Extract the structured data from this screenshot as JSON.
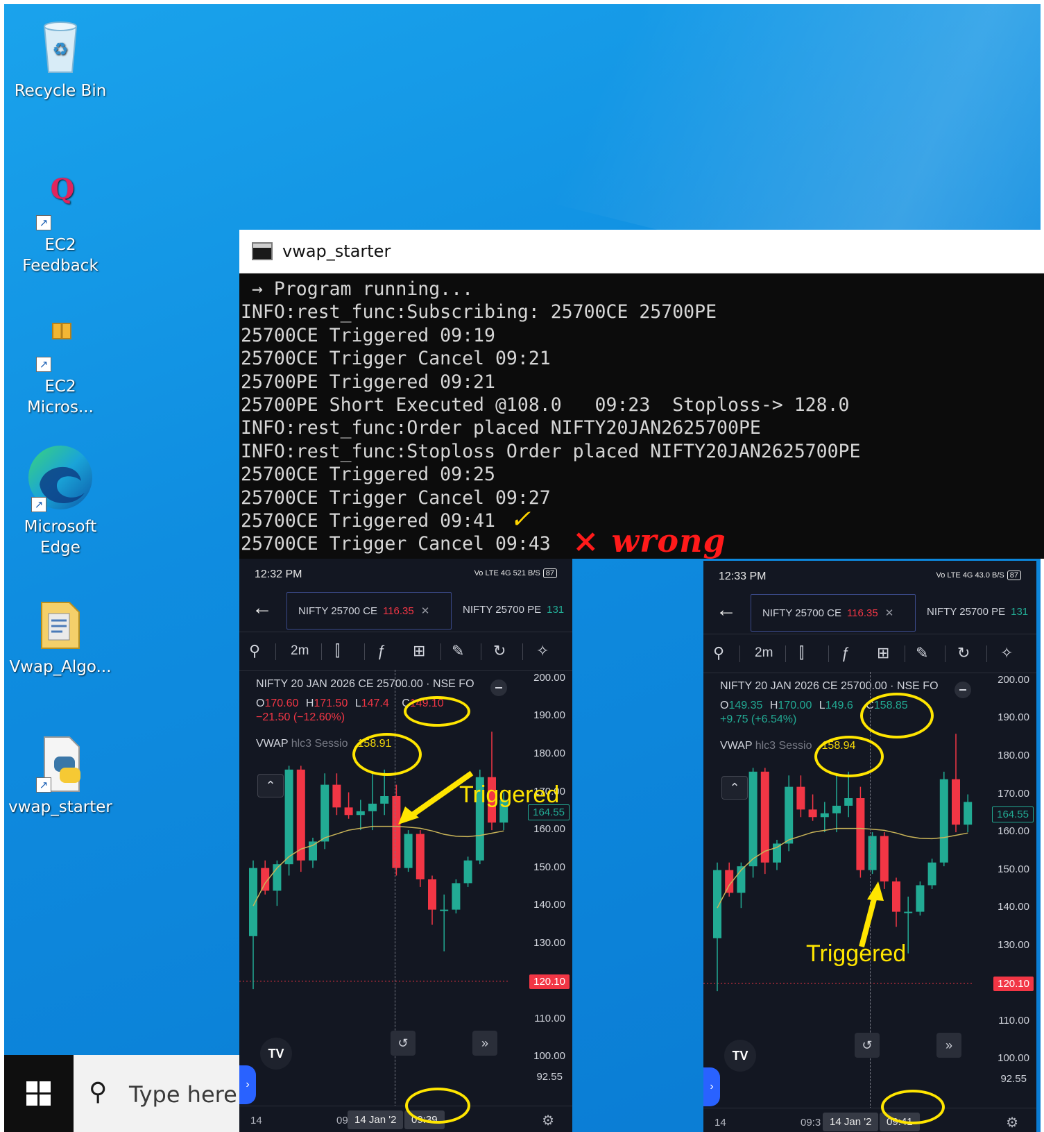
{
  "desktop_icons": [
    {
      "label": "Recycle Bin",
      "icon": "recycle-bin-icon"
    },
    {
      "label_lines": [
        "EC2",
        "Feedback"
      ],
      "icon": "q-icon"
    },
    {
      "label_lines": [
        "EC2",
        "Micros..."
      ],
      "icon": "package-icon"
    },
    {
      "label_lines": [
        "Microsoft",
        "Edge"
      ],
      "icon": "edge-icon"
    },
    {
      "label": "Vwap_Algo...",
      "icon": "folder-icon"
    },
    {
      "label": "vwap_starter",
      "icon": "python-file-icon"
    }
  ],
  "taskbar": {
    "search_placeholder": "Type here t"
  },
  "console": {
    "title": "vwap_starter",
    "lines": [
      " → Program running...",
      "INFO:rest_func:Subscribing: 25700CE 25700PE",
      "25700CE Triggered 09:19",
      "25700CE Trigger Cancel 09:21",
      "25700PE Triggered 09:21",
      "25700PE Short Executed @108.0   09:23  Stoploss-> 128.0",
      "INFO:rest_func:Order placed NIFTY20JAN2625700PE",
      "INFO:rest_func:Stoploss Order placed NIFTY20JAN2625700PE",
      "25700CE Triggered 09:25",
      "25700CE Trigger Cancel 09:27",
      "25700CE Triggered 09:41",
      "25700CE Trigger Cancel 09:43"
    ],
    "annotation_check": "✓",
    "annotation_wrong": "× wrong"
  },
  "phones": [
    {
      "status_time": "12:32 PM",
      "status_signal": "Vo LTE 4G 521 B/S",
      "battery": "87",
      "tab1_name": "NIFTY 25700 CE",
      "tab1_price": "116.35",
      "tab2_name": "NIFTY 25700 PE",
      "tab2_price": "131",
      "timeframe": "2m",
      "instrument": "NIFTY 20 JAN 2026 CE 25700.00 · NSE FO",
      "ohlc": {
        "o": "170.60",
        "h": "171.50",
        "l": "147.4",
        "c": "149.10"
      },
      "change": "−21.50 (−12.60%)",
      "vwap_label": "VWAP",
      "vwap_sub": "hlc3 Sessio",
      "vwap_value": "158.91",
      "y_ticks": [
        "200.00",
        "190.00",
        "180.00",
        "170.00",
        "160.00",
        "150.00",
        "140.00",
        "130.00",
        "120.10",
        "110.00",
        "100.00"
      ],
      "last_price_tag": "164.55",
      "marker_tag": "120.10",
      "low_value": "92.55",
      "x_left": "14",
      "x_mid": "09",
      "x_date": "14 Jan '2",
      "x_time": "09:39",
      "annotation": "Triggered"
    },
    {
      "status_time": "12:33 PM",
      "status_signal": "Vo LTE 4G 43.0 B/S",
      "battery": "87",
      "tab1_name": "NIFTY 25700 CE",
      "tab1_price": "116.35",
      "tab2_name": "NIFTY 25700 PE",
      "tab2_price": "131",
      "timeframe": "2m",
      "instrument": "NIFTY 20 JAN 2026 CE 25700.00 · NSE FO",
      "ohlc": {
        "o": "149.35",
        "h": "170.00",
        "l": "149.6",
        "c": "158.85"
      },
      "change": "+9.75 (+6.54%)",
      "vwap_label": "VWAP",
      "vwap_sub": "hlc3 Sessio",
      "vwap_value": "158.94",
      "y_ticks": [
        "200.00",
        "190.00",
        "180.00",
        "170.00",
        "160.00",
        "150.00",
        "140.00",
        "130.00",
        "120.10",
        "110.00",
        "100.00"
      ],
      "last_price_tag": "164.55",
      "marker_tag": "120.10",
      "low_value": "92.55",
      "x_left": "14",
      "x_mid": "09:3",
      "x_date": "14 Jan '2",
      "x_time": "09:41",
      "annotation": "Triggered"
    }
  ],
  "candles": [
    {
      "o": 132,
      "h": 152,
      "l": 118,
      "c": 150
    },
    {
      "o": 150,
      "h": 152,
      "l": 143,
      "c": 144
    },
    {
      "o": 144,
      "h": 152,
      "l": 140,
      "c": 151
    },
    {
      "o": 151,
      "h": 177,
      "l": 148,
      "c": 176
    },
    {
      "o": 176,
      "h": 177,
      "l": 149,
      "c": 152
    },
    {
      "o": 152,
      "h": 158,
      "l": 150,
      "c": 157
    },
    {
      "o": 157,
      "h": 175,
      "l": 155,
      "c": 172
    },
    {
      "o": 172,
      "h": 175,
      "l": 164,
      "c": 166
    },
    {
      "o": 166,
      "h": 170,
      "l": 163,
      "c": 164
    },
    {
      "o": 164,
      "h": 168,
      "l": 160,
      "c": 165
    },
    {
      "o": 165,
      "h": 175,
      "l": 160,
      "c": 167
    },
    {
      "o": 167,
      "h": 176,
      "l": 164,
      "c": 169
    },
    {
      "o": 169,
      "h": 172,
      "l": 148,
      "c": 150
    },
    {
      "o": 150,
      "h": 160,
      "l": 149,
      "c": 159
    },
    {
      "o": 159,
      "h": 160,
      "l": 145,
      "c": 147
    },
    {
      "o": 147,
      "h": 148,
      "l": 135,
      "c": 139
    },
    {
      "o": 139,
      "h": 143,
      "l": 128,
      "c": 139
    },
    {
      "o": 139,
      "h": 147,
      "l": 138,
      "c": 146
    },
    {
      "o": 146,
      "h": 153,
      "l": 145,
      "c": 152
    },
    {
      "o": 152,
      "h": 176,
      "l": 151,
      "c": 174
    },
    {
      "o": 174,
      "h": 186,
      "l": 160,
      "c": 162
    },
    {
      "o": 162,
      "h": 170,
      "l": 160,
      "c": 168
    }
  ],
  "vwap_curve": [
    140,
    146,
    150,
    153,
    155,
    156,
    158,
    159,
    160,
    160.5,
    161,
    161,
    161,
    160.8,
    160.5,
    159.8,
    158.9,
    158.4,
    158.3,
    158.6,
    159.2,
    159.8
  ],
  "colors": {
    "up": "#22ab94",
    "down": "#f23645",
    "vwap": "#c9b458",
    "annotation": "#ffe500"
  }
}
